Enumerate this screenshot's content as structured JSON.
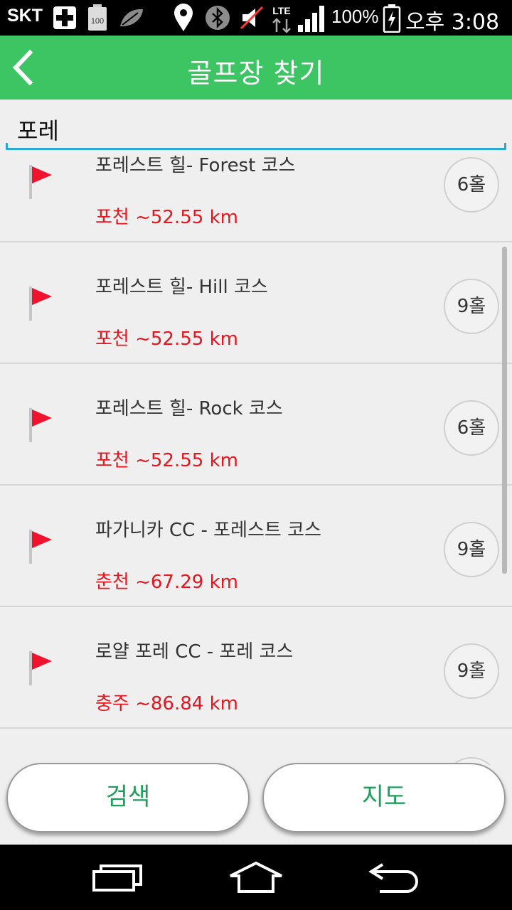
{
  "status_bar": {
    "carrier": "SKT",
    "battery_percent": "100%",
    "time": "오후 3:08",
    "icons": [
      "medical-cross-icon",
      "battery-100-icon",
      "leaf-icon",
      "location-pin-icon",
      "bluetooth-icon",
      "mute-icon",
      "lte-data-icon",
      "signal-strength-icon",
      "battery-charging-icon"
    ]
  },
  "header": {
    "title": "골프장 찾기",
    "back_icon": "chevron-left-icon"
  },
  "search": {
    "value": "포레",
    "underline_color": "#2aa6cf"
  },
  "results": [
    {
      "name": "포레스트 힐- Forest 코스",
      "distance": "포천 ~52.55 km",
      "holes": "6홀"
    },
    {
      "name": "포레스트 힐- Hill 코스",
      "distance": "포천 ~52.55 km",
      "holes": "9홀"
    },
    {
      "name": "포레스트 힐- Rock 코스",
      "distance": "포천 ~52.55 km",
      "holes": "6홀"
    },
    {
      "name": "파가니카 CC - 포레스트 코스",
      "distance": "춘천 ~67.29 km",
      "holes": "9홀"
    },
    {
      "name": "로얄 포레 CC - 포레 코스",
      "distance": "충주 ~86.84 km",
      "holes": "9홀"
    }
  ],
  "buttons": {
    "search_label": "검색",
    "map_label": "지도"
  },
  "navigation": [
    "recent-apps-icon",
    "home-icon",
    "back-icon"
  ],
  "colors": {
    "header": "#3ec563",
    "distance_text": "#e8141e",
    "flag": "#f0132d",
    "button_text": "#1fa05a"
  }
}
